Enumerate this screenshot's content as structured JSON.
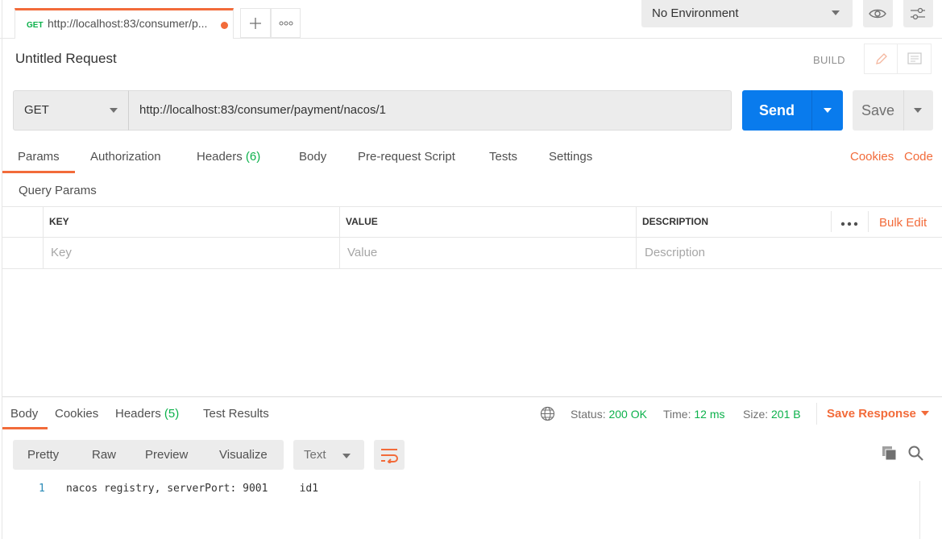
{
  "tab": {
    "method": "GET",
    "url": "http://localhost:83/consumer/p...",
    "add_icon": "plus-icon",
    "more_icon": "ellipsis-icon"
  },
  "environment": {
    "selected": "No Environment"
  },
  "request": {
    "title": "Untitled Request",
    "mode": "BUILD",
    "method": "GET",
    "url": "http://localhost:83/consumer/payment/nacos/1",
    "send_label": "Send",
    "save_label": "Save"
  },
  "request_tabs": {
    "params": "Params",
    "authorization": "Authorization",
    "headers": "Headers",
    "headers_count": "(6)",
    "body": "Body",
    "prerequest": "Pre-request Script",
    "tests": "Tests",
    "settings": "Settings",
    "cookies": "Cookies",
    "code": "Code"
  },
  "query_params": {
    "label": "Query Params",
    "columns": {
      "key": "KEY",
      "value": "VALUE",
      "description": "DESCRIPTION"
    },
    "placeholders": {
      "key": "Key",
      "value": "Value",
      "description": "Description"
    },
    "bulk_edit": "Bulk Edit"
  },
  "response_tabs": {
    "body": "Body",
    "cookies": "Cookies",
    "headers": "Headers",
    "headers_count": "(5)",
    "test_results": "Test Results"
  },
  "response_status": {
    "status_label": "Status:",
    "status_value": "200 OK",
    "time_label": "Time:",
    "time_value": "12 ms",
    "size_label": "Size:",
    "size_value": "201 B",
    "save_response": "Save Response"
  },
  "response_view": {
    "pretty": "Pretty",
    "raw": "Raw",
    "preview": "Preview",
    "visualize": "Visualize",
    "format": "Text"
  },
  "response_body": {
    "lines": [
      {
        "num": "1",
        "text": "nacos registry, serverPort: 9001     id1"
      }
    ]
  },
  "colors": {
    "accent": "#f26b3a",
    "send": "#097bed",
    "success": "#0cb14b"
  }
}
